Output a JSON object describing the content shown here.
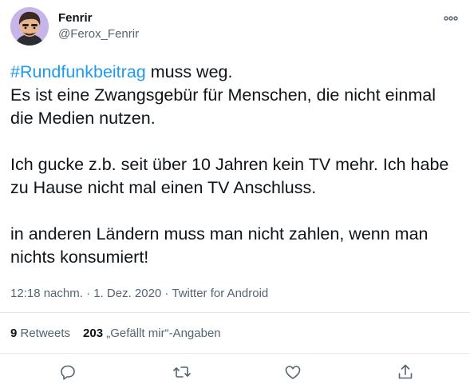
{
  "author": {
    "display_name": "Fenrir",
    "handle": "@Ferox_Fenrir"
  },
  "tweet": {
    "hashtag": "#Rundfunkbeitrag",
    "line1_rest": " muss weg.",
    "line2": "Es ist eine Zwangsgebür für Menschen, die nicht einmal die Medien nutzen.",
    "paragraph2": "Ich gucke z.b. seit über 10 Jahren kein TV mehr. Ich habe zu Hause nicht mal einen TV Anschluss.",
    "paragraph3": "in anderen Ländern muss man nicht zahlen, wenn man nichts konsumiert!"
  },
  "meta": {
    "time": "12:18 nachm.",
    "separator": " · ",
    "date": "1. Dez. 2020",
    "source": "Twitter for Android"
  },
  "stats": {
    "retweets_count": "9",
    "retweets_label": " Retweets",
    "likes_count": "203",
    "likes_label": " „Gefällt mir“-Angaben"
  },
  "icons": {
    "more": "more-icon",
    "reply": "reply-icon",
    "retweet": "retweet-icon",
    "like": "like-icon",
    "share": "share-icon"
  },
  "colors": {
    "accent": "#1d9bf0",
    "text": "#0f1419",
    "muted": "#536471",
    "border": "#e1e8ed"
  }
}
